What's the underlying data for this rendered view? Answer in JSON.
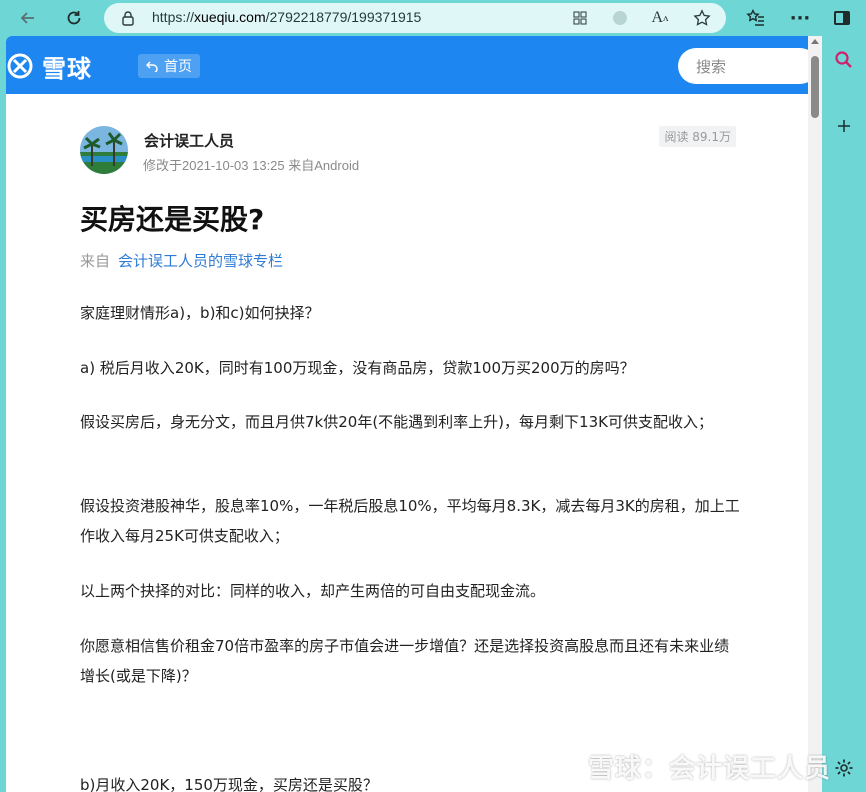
{
  "browser": {
    "url_prefix": "https://",
    "url_host": "xueqiu.com",
    "url_path": "/2792218779/199371915"
  },
  "site": {
    "logo_text": "雪球",
    "home_label": "首页",
    "search_placeholder": "搜索"
  },
  "post": {
    "author": "会计误工人员",
    "meta": "修改于2021-10-03 13:25  来自Android",
    "read_count": "阅读 89.1万",
    "title": "买房还是买股?",
    "from_label": "来自",
    "from_link": "会计误工人员的雪球专栏",
    "paragraphs": [
      "家庭理财情形a)，b)和c)如何抉择？",
      "a) 税后月收入20K，同时有100万现金，没有商品房，贷款100万买200万的房吗？",
      "假设买房后，身无分文，而且月供7k供20年(不能遇到利率上升)，每月剩下13K可供支配收入；",
      "假设投资港股神华，股息率10%，一年税后股息10%，平均每月8.3K，减去每月3K的房租，加上工作收入每月25K可供支配收入；",
      "以上两个抉择的对比：同样的收入，却产生两倍的可自由支配现金流。",
      "你愿意相信售价租金70倍市盈率的房子市值会进一步增值？还是选择投资高股息而且还有未来业绩增长(或是下降)？",
      "b)月收入20K，150万现金，买房还是买股？"
    ]
  },
  "watermark": "雪球：会计误工人员",
  "colors": {
    "chrome": "#6fd6d6",
    "header_blue": "#1d86f0",
    "link_blue": "#2e7bd6"
  }
}
